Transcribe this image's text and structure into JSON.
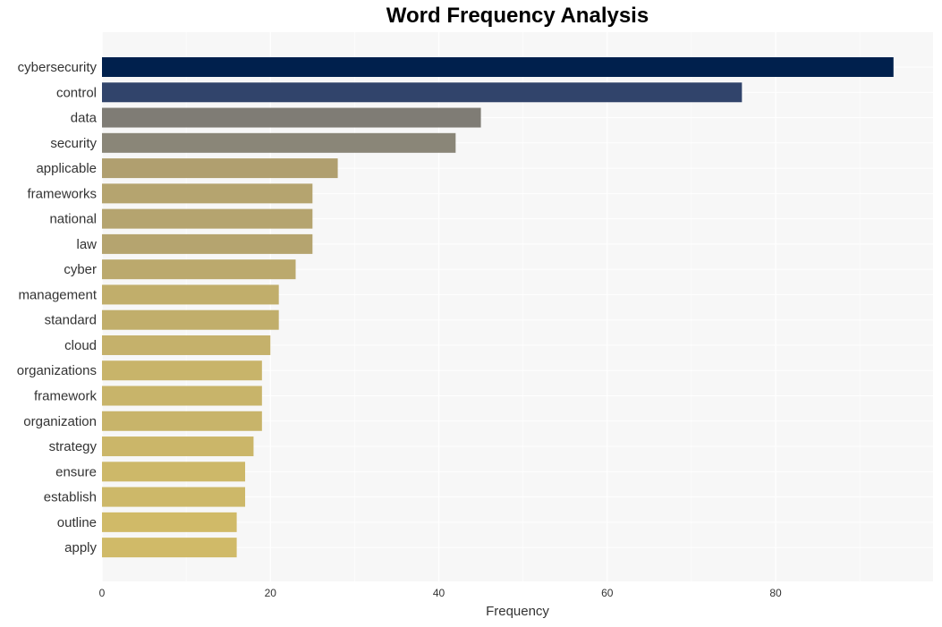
{
  "chart_data": {
    "type": "bar",
    "orientation": "horizontal",
    "title": "Word Frequency Analysis",
    "xlabel": "Frequency",
    "ylabel": "",
    "xlim": [
      0,
      98.5
    ],
    "xticks": [
      0,
      20,
      40,
      60,
      80
    ],
    "grid": true,
    "legend": "none",
    "categories": [
      "cybersecurity",
      "control",
      "data",
      "security",
      "applicable",
      "frameworks",
      "national",
      "law",
      "cyber",
      "management",
      "standard",
      "cloud",
      "organizations",
      "framework",
      "organization",
      "strategy",
      "ensure",
      "establish",
      "outline",
      "apply"
    ],
    "values": [
      94,
      76,
      45,
      42,
      28,
      25,
      25,
      25,
      23,
      21,
      21,
      20,
      19,
      19,
      19,
      18,
      17,
      17,
      16,
      16
    ],
    "colors": [
      "#00204d",
      "#31446b",
      "#7f7c75",
      "#8a8678",
      "#b09f6f",
      "#b5a46f",
      "#b5a46f",
      "#b5a46f",
      "#bba96d",
      "#c1ae6b",
      "#c1ae6b",
      "#c5b16b",
      "#c8b46a",
      "#c8b46a",
      "#c8b46a",
      "#cbb669",
      "#cdb869",
      "#cdb869",
      "#d0ba68",
      "#d0ba68"
    ]
  }
}
